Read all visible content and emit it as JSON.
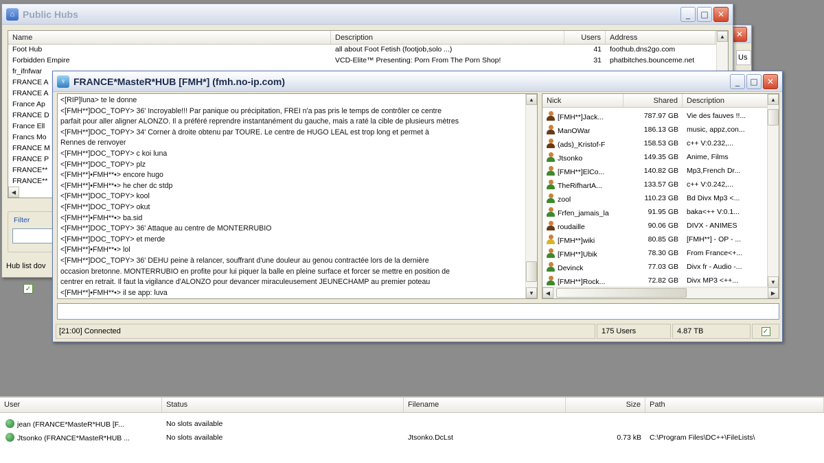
{
  "public_hubs": {
    "title": "Public Hubs",
    "columns": [
      "Name",
      "Description",
      "Users",
      "Address"
    ],
    "rows": [
      {
        "name": "Foot Hub",
        "description": "all about Foot Fetish (footjob,solo ...)",
        "users": "41",
        "address": "foothub.dns2go.com"
      },
      {
        "name": "Forbidden Empire",
        "description": "VCD-Elite™ Presenting: Porn From The Porn Shop!",
        "users": "31",
        "address": "phatbitches.bounceme.net"
      },
      {
        "name": "fr_ifnfwar",
        "description": "",
        "users": "",
        "address": ""
      },
      {
        "name": "FRANCE A",
        "description": "",
        "users": "",
        "address": ""
      },
      {
        "name": "FRANCE A",
        "description": "",
        "users": "",
        "address": ""
      },
      {
        "name": "France Ap",
        "description": "",
        "users": "",
        "address": ""
      },
      {
        "name": "FRANCE D",
        "description": "",
        "users": "",
        "address": ""
      },
      {
        "name": "France Ell",
        "description": "",
        "users": "",
        "address": ""
      },
      {
        "name": "Francs Mo",
        "description": "",
        "users": "",
        "address": ""
      },
      {
        "name": "FRANCE M",
        "description": "",
        "users": "",
        "address": ""
      },
      {
        "name": "FRANCE P",
        "description": "",
        "users": "",
        "address": ""
      },
      {
        "name": "FRANCE**",
        "description": "",
        "users": "",
        "address": ""
      },
      {
        "name": "FRANCE**",
        "description": "",
        "users": "",
        "address": ""
      }
    ],
    "filter_label": "Filter",
    "status_text": "Hub list dov"
  },
  "back_window": {
    "title_fragment": "Us"
  },
  "hub": {
    "title": "FRANCE*MasteR*HUB [FMH*] (fmh.no-ip.com)",
    "chat_lines": [
      "<[RIP]luna> te le donne",
      "<[FMH**]DOC_TOPY> 36'   Incroyable!!! Par panique ou précipitation, FREI n'a pas pris le temps de contrôler ce centre",
      "parfait pour aller aligner ALONZO. Il a préféré reprendre instantanément du gauche, mais a raté la cible de plusieurs mètres",
      "<[FMH**]DOC_TOPY> 34'   Corner à droite obtenu par TOURE. Le centre de HUGO LEAL est trop long et permet à",
      "Rennes de renvoyer",
      "<[FMH**]DOC_TOPY> c koi luna",
      "<[FMH**]DOC_TOPY> plz",
      "<[FMH**]•FMH**•> encore hugo",
      "<[FMH**]•FMH**•> he cher dc stdp",
      "<[FMH**]DOC_TOPY> kool",
      "<[FMH**]DOC_TOPY> okut",
      "<[FMH**]•FMH**•> ba.sid",
      "<[FMH**]DOC_TOPY> 36'   Attaque au centre de MONTERRUBIO",
      "<[FMH**]DOC_TOPY> et merde",
      "<[FMH**]•FMH**•> lol",
      "<[FMH**]DOC_TOPY> 36'   DEHU peine à relancer, souffrant d'une douleur au genou contractée lors de la dernière",
      "occasion bretonne. MONTERRUBIO en profite pour lui piquer la balle en pleine surface et forcer se mettre en position de",
      "centrer en retrait. Il faut la vigilance d'ALONZO pour devancer miraculeusement JEUNECHAMP au premier poteau",
      "<[FMH**]•FMH**•> il se app: luva"
    ],
    "user_columns": [
      "Nick",
      "Shared",
      "Description"
    ],
    "users": [
      {
        "nick": "[FMH**]Jack...",
        "shared": "787.97 GB",
        "description": "Vie des fauves !!...",
        "icon": "user-brown"
      },
      {
        "nick": "ManOWar",
        "shared": "186.13 GB",
        "description": "music, appz,con...",
        "icon": "user-brown"
      },
      {
        "nick": "(ads)_Kristof-F",
        "shared": "158.53 GB",
        "description": "c++ V:0.232,...",
        "icon": "user-brown"
      },
      {
        "nick": "Jtsonko",
        "shared": "149.35 GB",
        "description": "Anime, Films",
        "icon": "user-green"
      },
      {
        "nick": "[FMH**]ElCo...",
        "shared": "140.82 GB",
        "description": "Mp3,French Dr...",
        "icon": "user-green"
      },
      {
        "nick": "TheRifhartA...",
        "shared": "133.57 GB",
        "description": "c++ V:0.242,...",
        "icon": "user-green"
      },
      {
        "nick": "zool",
        "shared": "110.23 GB",
        "description": "Bd Divx Mp3 <...",
        "icon": "user-green"
      },
      {
        "nick": "Frfen_jamais_la",
        "shared": "91.95 GB",
        "description": "baka<++ V:0.1...",
        "icon": "user-green"
      },
      {
        "nick": "roudaille",
        "shared": "90.06 GB",
        "description": "DIVX - ANIMES",
        "icon": "user-brown"
      },
      {
        "nick": "[FMH**]wiki",
        "shared": "80.85 GB",
        "description": "[FMH**] - OP - ...",
        "icon": "user-yellow"
      },
      {
        "nick": "[FMH**]Ubik",
        "shared": "78.30 GB",
        "description": "From France<+...",
        "icon": "user-green"
      },
      {
        "nick": "Devinck",
        "shared": "77.03 GB",
        "description": "Divx fr - Audio -...",
        "icon": "user-green"
      },
      {
        "nick": "[FMH**]Rock...",
        "shared": "72.82 GB",
        "description": "Divx MP3 <++...",
        "icon": "user-green"
      }
    ],
    "status_connected": "[21:00] Connected",
    "status_users": "175 Users",
    "status_share": "4.87 TB"
  },
  "transfers": {
    "columns": [
      "User",
      "Status",
      "Filename",
      "Size",
      "Path"
    ],
    "rows": [
      {
        "user": "jean (FRANCE*MasteR*HUB [F...",
        "status": "No slots available",
        "filename": "",
        "size": "",
        "path": ""
      },
      {
        "user": "Jtsonko (FRANCE*MasteR*HUB ...",
        "status": "No slots available",
        "filename": "Jtsonko.DcLst",
        "size": "0.73 kB",
        "path": "C:\\Program Files\\DC++\\FileLists\\"
      }
    ]
  }
}
